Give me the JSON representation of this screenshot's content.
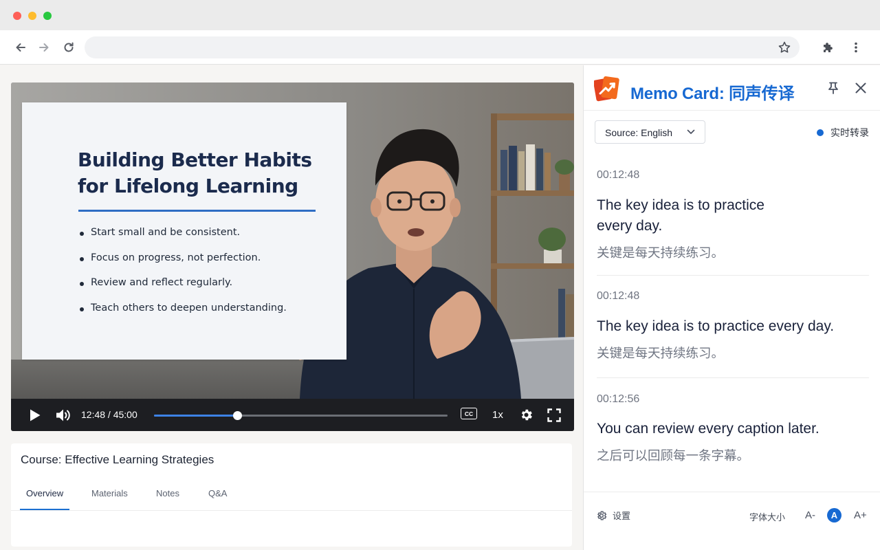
{
  "browser": {
    "url": "",
    "icons": [
      "back-icon",
      "forward-icon",
      "reload-icon",
      "bookmark-star-icon",
      "extensions-puzzle-icon",
      "more-vert-icon"
    ]
  },
  "video": {
    "slide": {
      "title_line1": "Building Better Habits",
      "title_line2": "for Lifelong Learning",
      "bullets": [
        "Start small and be consistent.",
        "Focus on progress, not perfection.",
        "Review and reflect regularly.",
        "Teach others to deepen understanding."
      ]
    },
    "controls": {
      "time": "12:48 / 45:00",
      "progress": 0.2844,
      "cc_label": "CC",
      "speed": "1x"
    }
  },
  "course": {
    "title": "Course: Effective Learning Strategies",
    "tabs": [
      {
        "label": "Overview",
        "active": true
      },
      {
        "label": "Materials",
        "active": false
      },
      {
        "label": "Notes",
        "active": false
      },
      {
        "label": "Q&A",
        "active": false
      }
    ]
  },
  "panel": {
    "title": "Memo Card: 同声传译",
    "accent": "#1769d2",
    "source_select": "Source: English",
    "live_label": "实时转录",
    "entries": [
      {
        "time": "00:12:48",
        "en_line1": "The key idea is to practice",
        "en_line2": "every day.",
        "zh": "关键是每天持续练习。"
      },
      {
        "time": "00:12:48",
        "en_line1": "The key idea is to practice every day.",
        "en_line2": "",
        "zh": "关键是每天持续练习。"
      },
      {
        "time": "00:12:56",
        "en_line1": "You can review every caption later.",
        "en_line2": "",
        "zh": "之后可以回顾每一条字幕。"
      }
    ],
    "footer": {
      "settings_label": "设置",
      "font_size_label": "字体大小",
      "font_decrease": "A-",
      "font_current": "A",
      "font_increase": "A+"
    }
  }
}
